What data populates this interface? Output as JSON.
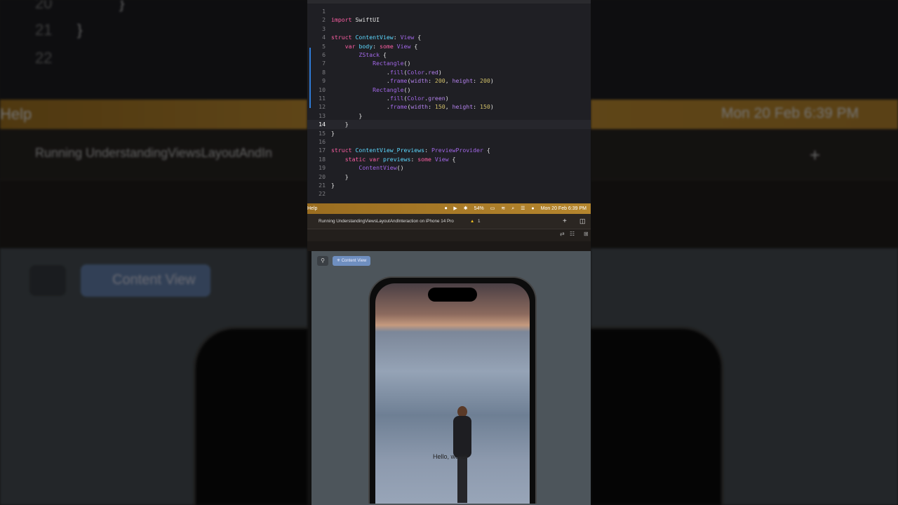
{
  "editor": {
    "current_line": 14,
    "lines": [
      [],
      [
        [
          "import",
          "kw"
        ],
        [
          " SwiftUI",
          "tx"
        ]
      ],
      [],
      [
        [
          "struct",
          "kw"
        ],
        [
          " ContentView",
          "ty"
        ],
        [
          ": ",
          "tx"
        ],
        [
          "View",
          "ty2"
        ],
        [
          " {",
          "tx"
        ]
      ],
      [
        [
          "    var",
          "kw"
        ],
        [
          " body",
          "ty"
        ],
        [
          ": ",
          "tx"
        ],
        [
          "some",
          "kw"
        ],
        [
          " View",
          "ty2"
        ],
        [
          " {",
          "tx"
        ]
      ],
      [
        [
          "        ZStack",
          "ty2"
        ],
        [
          " {",
          "tx"
        ]
      ],
      [
        [
          "            Rectangle",
          "ty2"
        ],
        [
          "()",
          "tx"
        ]
      ],
      [
        [
          "                .",
          "tx"
        ],
        [
          "fill",
          "fn"
        ],
        [
          "(",
          "tx"
        ],
        [
          "Color",
          "ty2"
        ],
        [
          ".",
          "tx"
        ],
        [
          "red",
          "pl"
        ],
        [
          ")",
          "tx"
        ]
      ],
      [
        [
          "                .",
          "tx"
        ],
        [
          "frame",
          "fn"
        ],
        [
          "(",
          "tx"
        ],
        [
          "width",
          "pl"
        ],
        [
          ": ",
          "tx"
        ],
        [
          "200",
          "num"
        ],
        [
          ", ",
          "tx"
        ],
        [
          "height",
          "pl"
        ],
        [
          ": ",
          "tx"
        ],
        [
          "200",
          "num"
        ],
        [
          ")",
          "tx"
        ]
      ],
      [
        [
          "            Rectangle",
          "ty2"
        ],
        [
          "()",
          "tx"
        ]
      ],
      [
        [
          "                .",
          "tx"
        ],
        [
          "fill",
          "fn"
        ],
        [
          "(",
          "tx"
        ],
        [
          "Color",
          "ty2"
        ],
        [
          ".",
          "tx"
        ],
        [
          "green",
          "pl"
        ],
        [
          ")",
          "tx"
        ]
      ],
      [
        [
          "                .",
          "tx"
        ],
        [
          "frame",
          "fn"
        ],
        [
          "(",
          "tx"
        ],
        [
          "width",
          "pl"
        ],
        [
          ": ",
          "tx"
        ],
        [
          "150",
          "num"
        ],
        [
          ", ",
          "tx"
        ],
        [
          "height",
          "pl"
        ],
        [
          ": ",
          "tx"
        ],
        [
          "150",
          "num"
        ],
        [
          ")",
          "tx"
        ]
      ],
      [
        [
          "        }",
          "tx"
        ]
      ],
      [
        [
          "    }",
          "tx"
        ]
      ],
      [
        [
          "}",
          "tx"
        ]
      ],
      [],
      [
        [
          "struct",
          "kw"
        ],
        [
          " ContentView_Previews",
          "ty"
        ],
        [
          ": ",
          "tx"
        ],
        [
          "PreviewProvider",
          "ty2"
        ],
        [
          " {",
          "tx"
        ]
      ],
      [
        [
          "    static",
          "kw"
        ],
        [
          " var",
          "kw"
        ],
        [
          " previews",
          "ty"
        ],
        [
          ": ",
          "tx"
        ],
        [
          "some",
          "kw"
        ],
        [
          " View",
          "ty2"
        ],
        [
          " {",
          "tx"
        ]
      ],
      [
        [
          "        ContentView",
          "ty2"
        ],
        [
          "()",
          "tx"
        ]
      ],
      [
        [
          "    }",
          "tx"
        ]
      ],
      [
        [
          "}",
          "tx"
        ]
      ],
      []
    ]
  },
  "menubar": {
    "menu": "Help",
    "battery": "54%",
    "datetime": "Mon 20 Feb  6:39 PM"
  },
  "toolbar": {
    "status": "Running UnderstandingViewsLayoutAndInteraction on iPhone 14 Pro",
    "warning_count": "1",
    "add": "+"
  },
  "preview": {
    "pin": "⚲",
    "button": "Content View",
    "hello": "Hello, world!"
  },
  "background": {
    "left_lines": [
      "20",
      "21",
      "22"
    ],
    "left_braces": [
      "}",
      "}"
    ],
    "left_menu": "Help",
    "left_status": "Running UnderstandingViewsLayoutAndIn",
    "left_button": "Content View",
    "right_datetime": "Mon 20 Feb  6:39 PM"
  }
}
